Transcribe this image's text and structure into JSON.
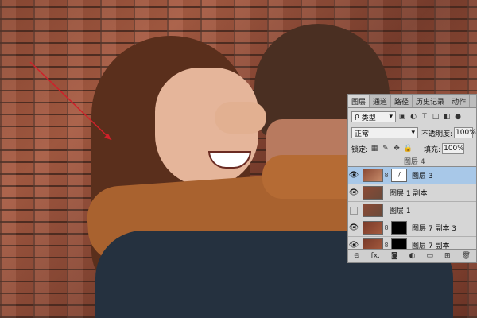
{
  "panel": {
    "tabs": [
      "图层",
      "通道",
      "路径",
      "历史记录",
      "动作"
    ],
    "filter_kind": "类型",
    "blend_mode": "正常",
    "opacity_label": "不透明度:",
    "opacity_value": "100%",
    "lock_label": "锁定:",
    "fill_label": "填充:",
    "fill_value": "100%",
    "top_partial_layer": "图层 4",
    "layers": [
      {
        "name": "图层 3",
        "visible": true,
        "active": true
      },
      {
        "name": "图层 1 副本",
        "visible": true,
        "active": false
      },
      {
        "name": "图层 1",
        "visible": false,
        "active": false
      },
      {
        "name": "图层 7 副本 3",
        "visible": true,
        "active": false
      },
      {
        "name": "图层 7 副本",
        "visible": true,
        "active": false
      }
    ],
    "bottom_icons": [
      "link-icon",
      "fx-icon",
      "mask-icon",
      "adjustment-icon",
      "group-icon",
      "new-layer-icon",
      "trash-icon"
    ],
    "fx_label": "fx."
  },
  "colors": {
    "annotation": "#d0202a",
    "selected_layer": "#a8c8e8"
  }
}
